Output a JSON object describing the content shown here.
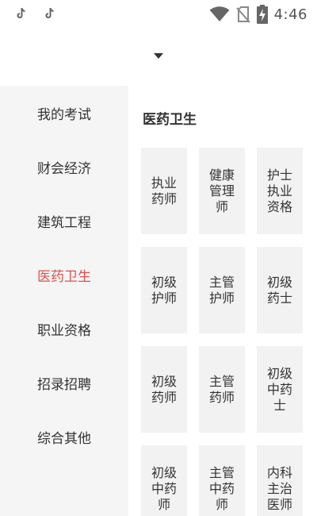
{
  "status_bar": {
    "time": "4:46",
    "icons": [
      "tiktok-icon",
      "tiktok-icon",
      "wifi-icon",
      "no-sim-icon",
      "battery-charging-icon"
    ]
  },
  "header": {
    "dropdown_icon": "caret-down-icon"
  },
  "sidebar": {
    "items": [
      {
        "label": "我的考试"
      },
      {
        "label": "财会经济"
      },
      {
        "label": "建筑工程"
      },
      {
        "label": "医药卫生"
      },
      {
        "label": "职业资格"
      },
      {
        "label": "招录招聘"
      },
      {
        "label": "综合其他"
      }
    ],
    "active_index": 3,
    "active_color": "#d9534f"
  },
  "main": {
    "section_title": "医药卫生",
    "tiles": [
      {
        "label": "执业药师"
      },
      {
        "label": "健康管理师"
      },
      {
        "label": "护士执业资格"
      },
      {
        "label": "初级护师"
      },
      {
        "label": "主管护师"
      },
      {
        "label": "初级药士"
      },
      {
        "label": "初级药师"
      },
      {
        "label": "主管药师"
      },
      {
        "label": "初级中药士"
      },
      {
        "label": "初级中药师"
      },
      {
        "label": "主管中药师"
      },
      {
        "label": "内科主治医师"
      }
    ]
  }
}
